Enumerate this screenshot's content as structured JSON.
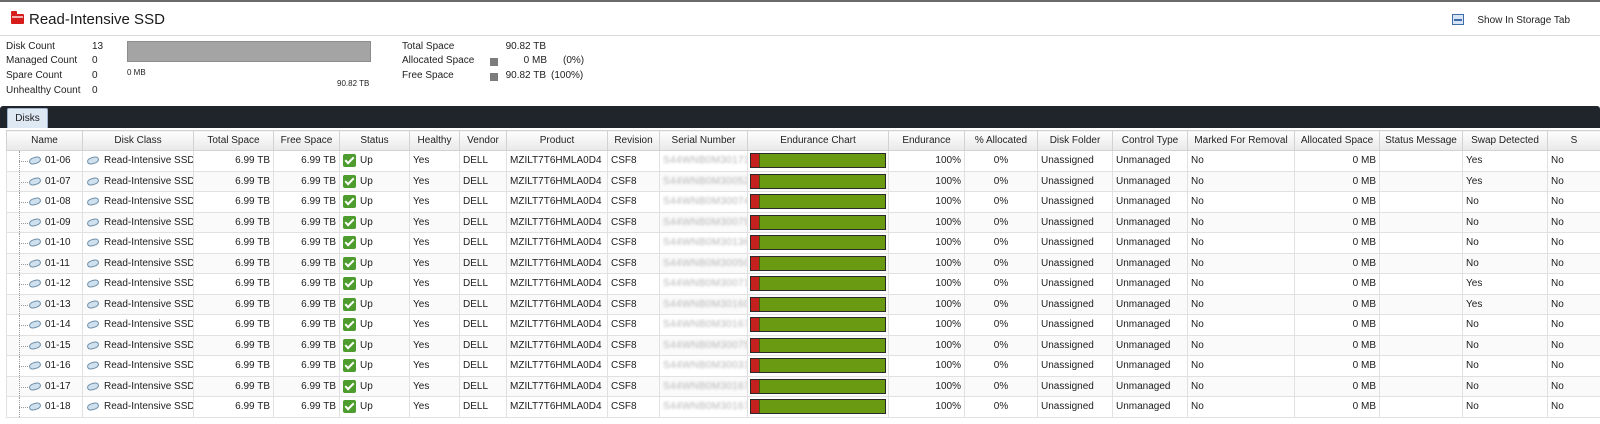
{
  "header": {
    "title": "Read-Intensive SSD",
    "show_in_storage_tab": "Show In Storage Tab"
  },
  "stats": [
    {
      "label": "Disk Count",
      "value": "13"
    },
    {
      "label": "Managed Count",
      "value": "0"
    },
    {
      "label": "Spare Count",
      "value": "0"
    },
    {
      "label": "Unhealthy Count",
      "value": "0"
    }
  ],
  "usage_bar": {
    "min_label": "0 MB",
    "max_label": "90.82 TB",
    "used_fraction": 0
  },
  "space": [
    {
      "label": "Total Space",
      "value": "90.82 TB",
      "pct": ""
    },
    {
      "label": "Allocated Space",
      "value": "0 MB",
      "pct": "(0%)"
    },
    {
      "label": "Free Space",
      "value": "90.82 TB",
      "pct": "(100%)"
    }
  ],
  "tabs": [
    {
      "label": "Disks"
    }
  ],
  "columns": [
    "Name",
    "Disk Class",
    "Total Space",
    "Free Space",
    "Status",
    "Healthy",
    "Vendor",
    "Product",
    "Revision",
    "Serial Number",
    "Endurance Chart",
    "Endurance",
    "% Allocated",
    "Disk Folder",
    "Control Type",
    "Marked For Removal",
    "Allocated Space",
    "Status Message",
    "Swap Detected",
    "S"
  ],
  "rows": [
    {
      "name": "01-06",
      "disk_class": "Read-Intensive SSD",
      "total": "6.99 TB",
      "free": "6.99 TB",
      "status": "Up",
      "healthy": "Yes",
      "vendor": "DELL",
      "product": "MZILT7T6HMLA0D4",
      "revision": "CSF8",
      "serial": "S44WNB0M301736",
      "endurance_level": 1.0,
      "endurance": "100%",
      "allocated_pct": "0%",
      "folder": "Unassigned",
      "control": "Unmanaged",
      "marked": "No",
      "allocated": "0 MB",
      "message": "",
      "swap": "Yes",
      "s": "No"
    },
    {
      "name": "01-07",
      "disk_class": "Read-Intensive SSD",
      "total": "6.99 TB",
      "free": "6.99 TB",
      "status": "Up",
      "healthy": "Yes",
      "vendor": "DELL",
      "product": "MZILT7T6HMLA0D4",
      "revision": "CSF8",
      "serial": "S44WNB0M300527",
      "endurance_level": 1.0,
      "endurance": "100%",
      "allocated_pct": "0%",
      "folder": "Unassigned",
      "control": "Unmanaged",
      "marked": "No",
      "allocated": "0 MB",
      "message": "",
      "swap": "Yes",
      "s": "No"
    },
    {
      "name": "01-08",
      "disk_class": "Read-Intensive SSD",
      "total": "6.99 TB",
      "free": "6.99 TB",
      "status": "Up",
      "healthy": "Yes",
      "vendor": "DELL",
      "product": "MZILT7T6HMLA0D4",
      "revision": "CSF8",
      "serial": "S44WNB0M300749",
      "endurance_level": 1.0,
      "endurance": "100%",
      "allocated_pct": "0%",
      "folder": "Unassigned",
      "control": "Unmanaged",
      "marked": "No",
      "allocated": "0 MB",
      "message": "",
      "swap": "No",
      "s": "No"
    },
    {
      "name": "01-09",
      "disk_class": "Read-Intensive SSD",
      "total": "6.99 TB",
      "free": "6.99 TB",
      "status": "Up",
      "healthy": "Yes",
      "vendor": "DELL",
      "product": "MZILT7T6HMLA0D4",
      "revision": "CSF8",
      "serial": "S44WNB0M300751",
      "endurance_level": 1.0,
      "endurance": "100%",
      "allocated_pct": "0%",
      "folder": "Unassigned",
      "control": "Unmanaged",
      "marked": "No",
      "allocated": "0 MB",
      "message": "",
      "swap": "No",
      "s": "No"
    },
    {
      "name": "01-10",
      "disk_class": "Read-Intensive SSD",
      "total": "6.99 TB",
      "free": "6.99 TB",
      "status": "Up",
      "healthy": "Yes",
      "vendor": "DELL",
      "product": "MZILT7T6HMLA0D4",
      "revision": "CSF8",
      "serial": "S44WNB0M301361",
      "endurance_level": 1.0,
      "endurance": "100%",
      "allocated_pct": "0%",
      "folder": "Unassigned",
      "control": "Unmanaged",
      "marked": "No",
      "allocated": "0 MB",
      "message": "",
      "swap": "No",
      "s": "No"
    },
    {
      "name": "01-11",
      "disk_class": "Read-Intensive SSD",
      "total": "6.99 TB",
      "free": "6.99 TB",
      "status": "Up",
      "healthy": "Yes",
      "vendor": "DELL",
      "product": "MZILT7T6HMLA0D4",
      "revision": "CSF8",
      "serial": "S44WNB0M300502",
      "endurance_level": 1.0,
      "endurance": "100%",
      "allocated_pct": "0%",
      "folder": "Unassigned",
      "control": "Unmanaged",
      "marked": "No",
      "allocated": "0 MB",
      "message": "",
      "swap": "No",
      "s": "No"
    },
    {
      "name": "01-12",
      "disk_class": "Read-Intensive SSD",
      "total": "6.99 TB",
      "free": "6.99 TB",
      "status": "Up",
      "healthy": "Yes",
      "vendor": "DELL",
      "product": "MZILT7T6HMLA0D4",
      "revision": "CSF8",
      "serial": "S44WNB0M300714",
      "endurance_level": 1.0,
      "endurance": "100%",
      "allocated_pct": "0%",
      "folder": "Unassigned",
      "control": "Unmanaged",
      "marked": "No",
      "allocated": "0 MB",
      "message": "",
      "swap": "Yes",
      "s": "No"
    },
    {
      "name": "01-13",
      "disk_class": "Read-Intensive SSD",
      "total": "6.99 TB",
      "free": "6.99 TB",
      "status": "Up",
      "healthy": "Yes",
      "vendor": "DELL",
      "product": "MZILT7T6HMLA0D4",
      "revision": "CSF8",
      "serial": "S44WNB0M301607",
      "endurance_level": 1.0,
      "endurance": "100%",
      "allocated_pct": "0%",
      "folder": "Unassigned",
      "control": "Unmanaged",
      "marked": "No",
      "allocated": "0 MB",
      "message": "",
      "swap": "Yes",
      "s": "No"
    },
    {
      "name": "01-14",
      "disk_class": "Read-Intensive SSD",
      "total": "6.99 TB",
      "free": "6.99 TB",
      "status": "Up",
      "healthy": "Yes",
      "vendor": "DELL",
      "product": "MZILT7T6HMLA0D4",
      "revision": "CSF8",
      "serial": "S44WNB0M301677",
      "endurance_level": 1.0,
      "endurance": "100%",
      "allocated_pct": "0%",
      "folder": "Unassigned",
      "control": "Unmanaged",
      "marked": "No",
      "allocated": "0 MB",
      "message": "",
      "swap": "No",
      "s": "No"
    },
    {
      "name": "01-15",
      "disk_class": "Read-Intensive SSD",
      "total": "6.99 TB",
      "free": "6.99 TB",
      "status": "Up",
      "healthy": "Yes",
      "vendor": "DELL",
      "product": "MZILT7T6HMLA0D4",
      "revision": "CSF8",
      "serial": "S44WNB0M300758",
      "endurance_level": 1.0,
      "endurance": "100%",
      "allocated_pct": "0%",
      "folder": "Unassigned",
      "control": "Unmanaged",
      "marked": "No",
      "allocated": "0 MB",
      "message": "",
      "swap": "No",
      "s": "No"
    },
    {
      "name": "01-16",
      "disk_class": "Read-Intensive SSD",
      "total": "6.99 TB",
      "free": "6.99 TB",
      "status": "Up",
      "healthy": "Yes",
      "vendor": "DELL",
      "product": "MZILT7T6HMLA0D4",
      "revision": "CSF8",
      "serial": "S44WNB0M300311",
      "endurance_level": 1.0,
      "endurance": "100%",
      "allocated_pct": "0%",
      "folder": "Unassigned",
      "control": "Unmanaged",
      "marked": "No",
      "allocated": "0 MB",
      "message": "",
      "swap": "No",
      "s": "No"
    },
    {
      "name": "01-17",
      "disk_class": "Read-Intensive SSD",
      "total": "6.99 TB",
      "free": "6.99 TB",
      "status": "Up",
      "healthy": "Yes",
      "vendor": "DELL",
      "product": "MZILT7T6HMLA0D4",
      "revision": "CSF8",
      "serial": "S44WNB0M301676",
      "endurance_level": 1.0,
      "endurance": "100%",
      "allocated_pct": "0%",
      "folder": "Unassigned",
      "control": "Unmanaged",
      "marked": "No",
      "allocated": "0 MB",
      "message": "",
      "swap": "No",
      "s": "No"
    },
    {
      "name": "01-18",
      "disk_class": "Read-Intensive SSD",
      "total": "6.99 TB",
      "free": "6.99 TB",
      "status": "Up",
      "healthy": "Yes",
      "vendor": "DELL",
      "product": "MZILT7T6HMLA0D4",
      "revision": "CSF8",
      "serial": "S44WNB0M301675",
      "endurance_level": 1.0,
      "endurance": "100%",
      "allocated_pct": "0%",
      "folder": "Unassigned",
      "control": "Unmanaged",
      "marked": "No",
      "allocated": "0 MB",
      "message": "",
      "swap": "No",
      "s": "No"
    }
  ],
  "icons": {
    "title": "folder-icon",
    "storage_tab": "storage-tab-icon",
    "disk": "disk-icon",
    "status": "checkmark-icon"
  },
  "colors": {
    "status_ok": "#4e9c2e",
    "endurance_good": "#6a9a12",
    "endurance_bad": "#c42020",
    "title_icon": "#d71c1c"
  }
}
